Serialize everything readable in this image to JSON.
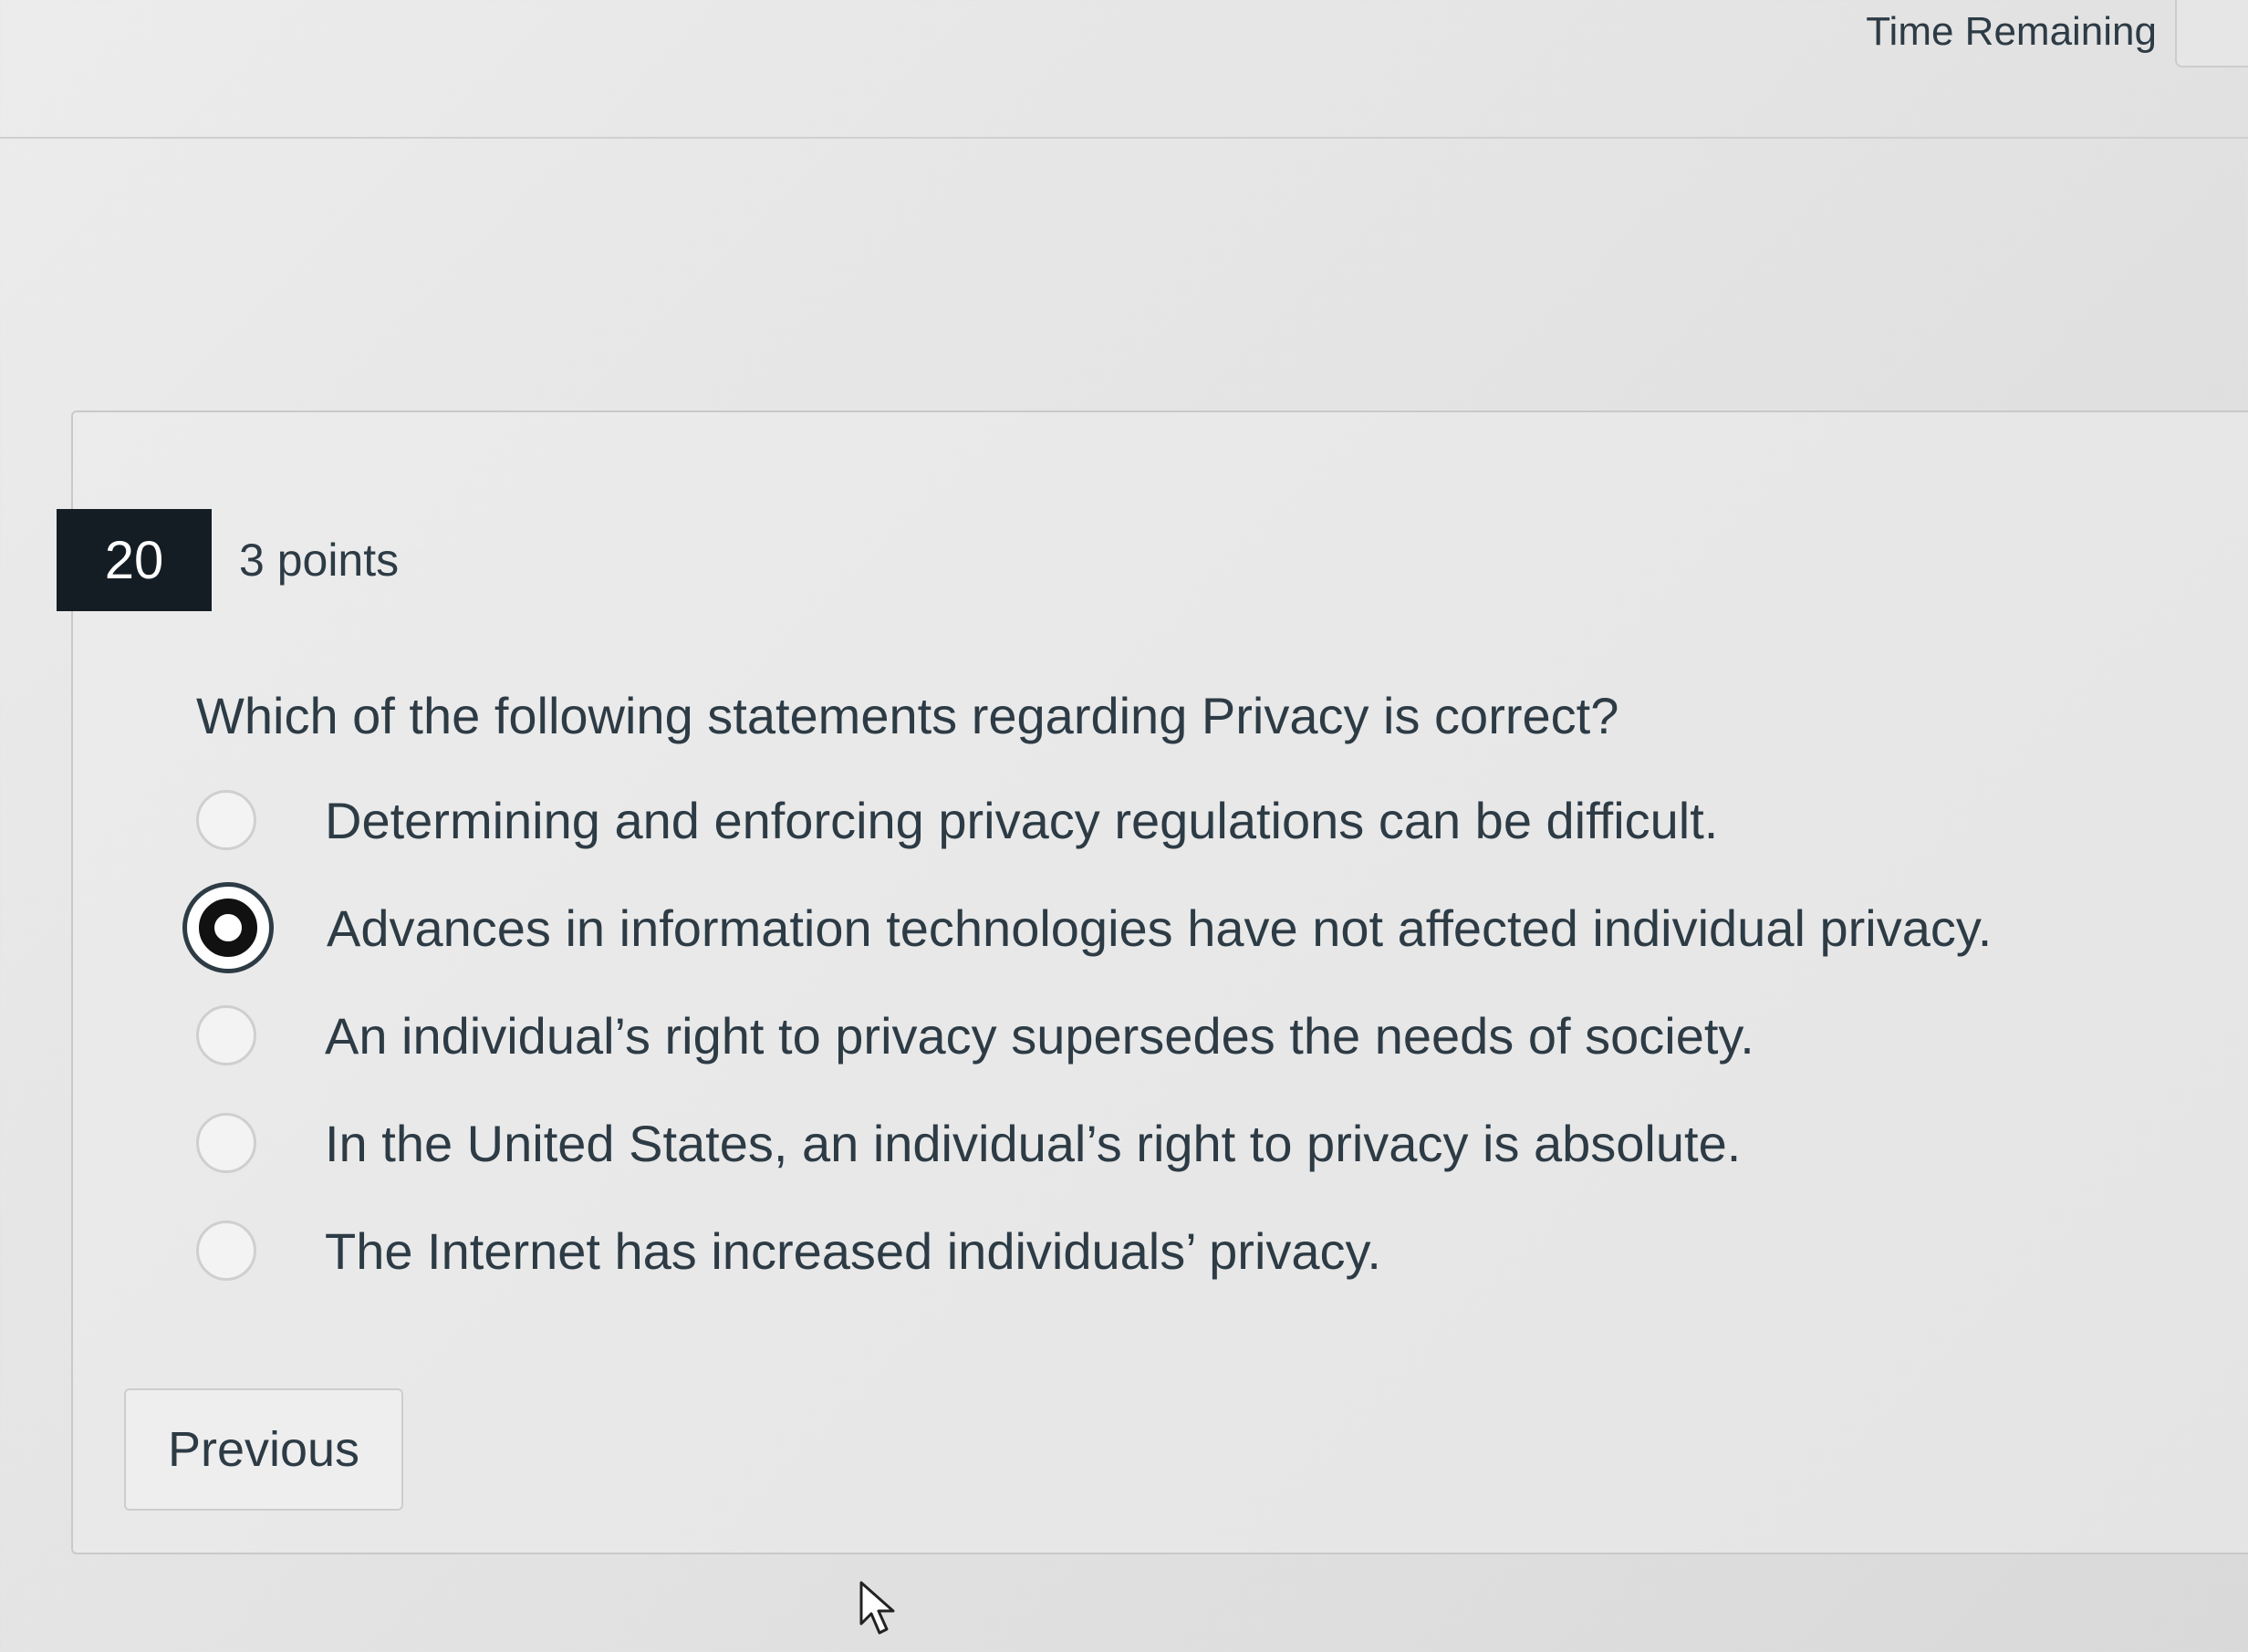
{
  "timer": {
    "label": "Time Remaining"
  },
  "question": {
    "number": "20",
    "points": "3 points",
    "text": "Which of the following statements regarding Privacy is correct?",
    "answers": [
      {
        "label": "Determining and enforcing privacy regulations can be difficult.",
        "selected": false
      },
      {
        "label": "Advances in information technologies have not affected individual privacy.",
        "selected": true
      },
      {
        "label": "An individual’s right to privacy supersedes the needs of society.",
        "selected": false
      },
      {
        "label": "In the United States, an individual’s right to privacy is absolute.",
        "selected": false
      },
      {
        "label": "The Internet has increased individuals’ privacy.",
        "selected": false
      }
    ]
  },
  "navigation": {
    "previous_label": "Previous"
  },
  "icons": {
    "cursor": "mouse-pointer-icon"
  }
}
